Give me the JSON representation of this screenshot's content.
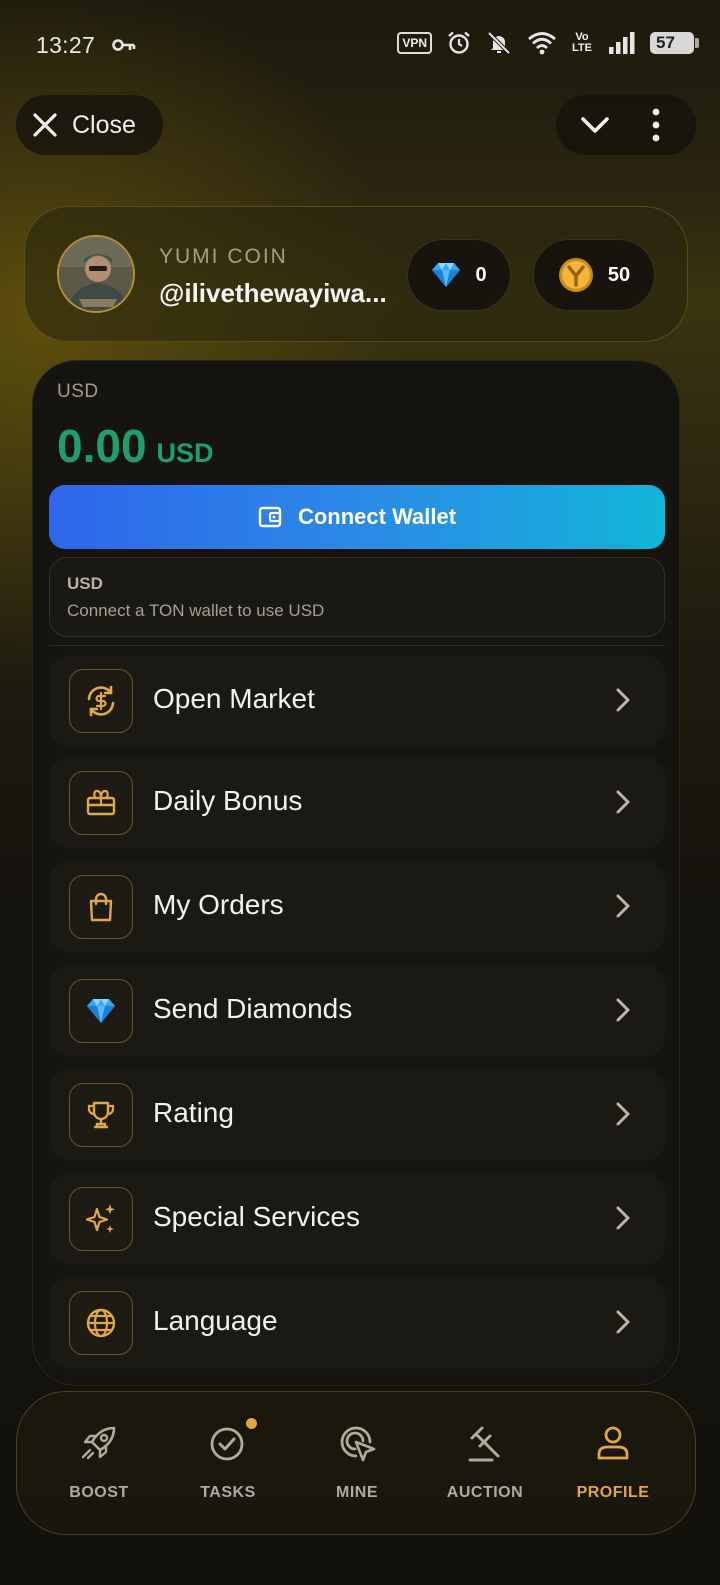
{
  "status_bar": {
    "time": "13:27",
    "vpn": "VPN",
    "volte_top": "Vo",
    "volte_bottom": "LTE",
    "battery": "57"
  },
  "top_bar": {
    "close_label": "Close"
  },
  "profile": {
    "app_name": "YUMI COIN",
    "username": "@ilivethewayiwa...",
    "diamonds": "0",
    "coins": "50"
  },
  "wallet": {
    "currency_label": "USD",
    "balance_amount": "0.00",
    "balance_currency": "USD",
    "connect_label": "Connect Wallet",
    "info_title": "USD",
    "info_subtitle": "Connect a TON wallet to use USD"
  },
  "menu": [
    {
      "label": "Open Market",
      "icon": "exchange-dollar-icon"
    },
    {
      "label": "Daily Bonus",
      "icon": "gift-icon"
    },
    {
      "label": "My Orders",
      "icon": "shopping-bag-icon"
    },
    {
      "label": "Send Diamonds",
      "icon": "diamond-icon"
    },
    {
      "label": "Rating",
      "icon": "trophy-icon"
    },
    {
      "label": "Special Services",
      "icon": "sparkles-icon"
    },
    {
      "label": "Language",
      "icon": "globe-icon"
    }
  ],
  "nav": [
    {
      "label": "BOOST",
      "icon": "rocket-icon"
    },
    {
      "label": "TASKS",
      "icon": "check-circle-icon"
    },
    {
      "label": "MINE",
      "icon": "cursor-click-icon"
    },
    {
      "label": "AUCTION",
      "icon": "gavel-icon"
    },
    {
      "label": "PROFILE",
      "icon": "user-icon",
      "active": true
    }
  ],
  "colors": {
    "accent_gold": "#e0a84b",
    "balance_green": "#1fa06a",
    "connect_gradient_start": "#2f66ea",
    "connect_gradient_end": "#11b6d8"
  }
}
